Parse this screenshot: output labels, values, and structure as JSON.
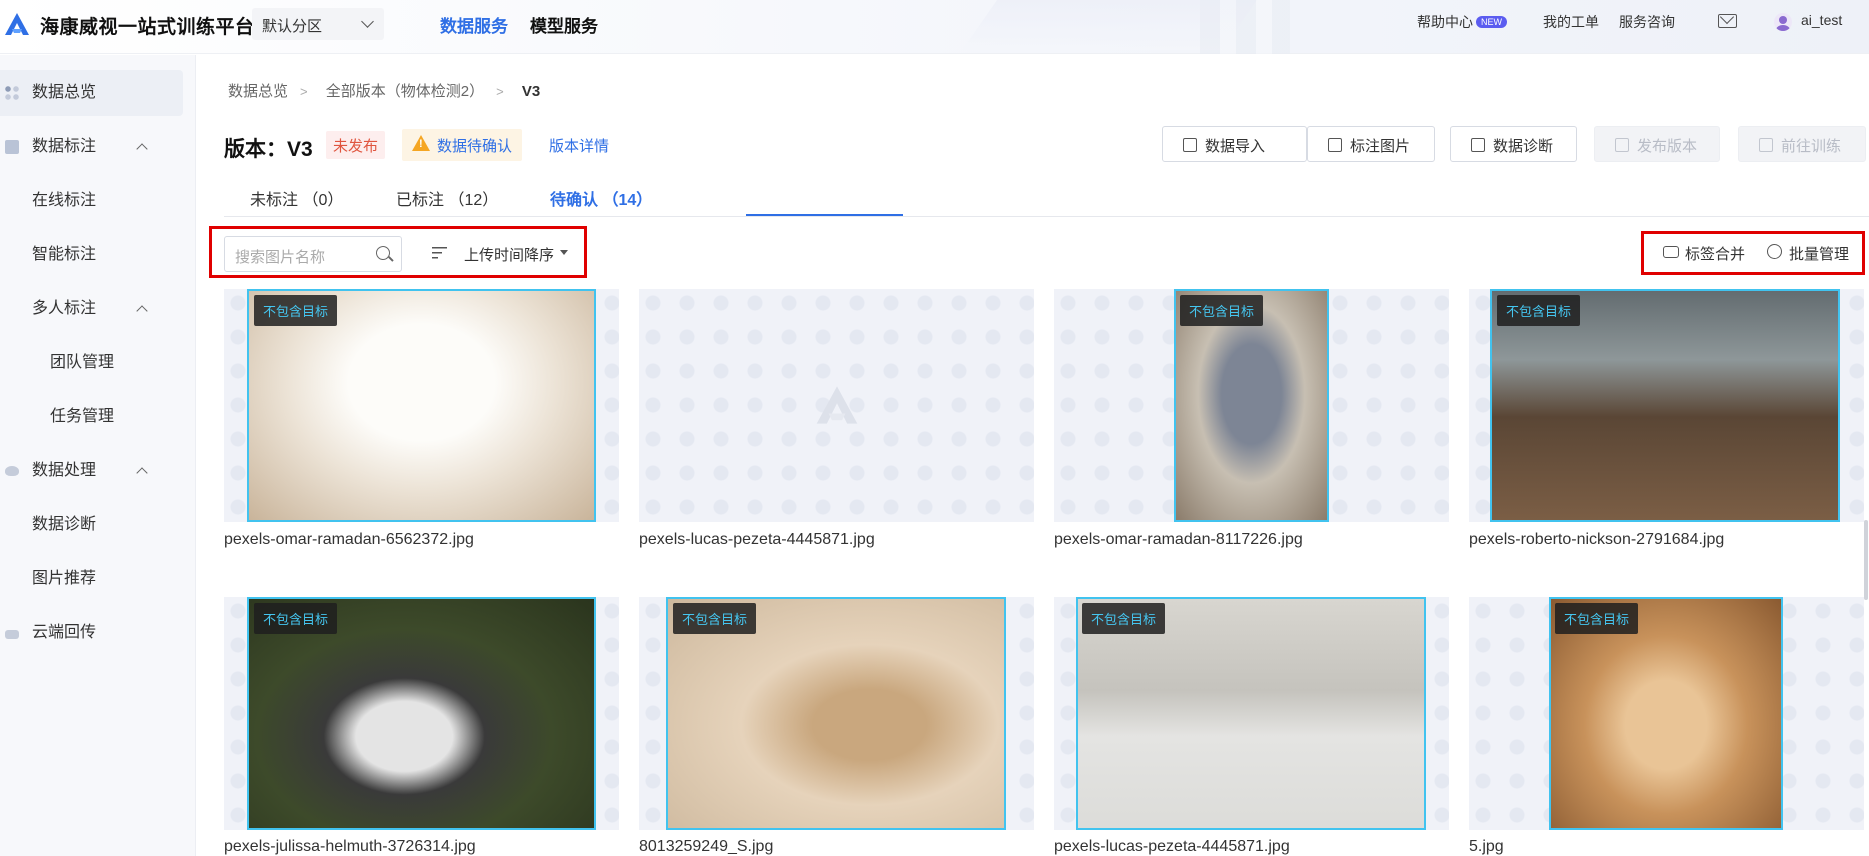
{
  "header": {
    "app_title": "海康威视一站式训练平台",
    "partition": "默认分区",
    "nav": [
      "数据服务",
      "模型服务"
    ],
    "help": "帮助中心",
    "new_badge": "NEW",
    "my_tickets": "我的工单",
    "consult": "服务咨询",
    "user": "ai_test"
  },
  "sidebar": {
    "items": [
      {
        "label": "数据总览",
        "icon": "grid-icon"
      },
      {
        "label": "数据标注",
        "icon": "doc-icon"
      },
      {
        "label": "在线标注"
      },
      {
        "label": "智能标注"
      },
      {
        "label": "多人标注"
      },
      {
        "label": "团队管理"
      },
      {
        "label": "任务管理"
      },
      {
        "label": "数据处理",
        "icon": "leaf-icon"
      },
      {
        "label": "数据诊断"
      },
      {
        "label": "图片推荐"
      },
      {
        "label": "云端回传",
        "icon": "cloud-icon"
      }
    ]
  },
  "breadcrumb": [
    "数据总览",
    "全部版本（物体检测2）",
    "V3"
  ],
  "version": {
    "title": "版本：V3",
    "status_tag": "未发布",
    "pending_tag": "数据待确认",
    "detail_link": "版本详情"
  },
  "toolbar": {
    "import": "数据导入",
    "annotate": "标注图片",
    "diagnose": "数据诊断",
    "publish": "发布版本",
    "train": "前往训练"
  },
  "tabs": [
    "未标注 （0）",
    "已标注 （12）",
    "待确认 （14）"
  ],
  "filters": {
    "search_placeholder": "搜索图片名称",
    "sort": "上传时间降序"
  },
  "actions": {
    "merge": "标签合并",
    "batch": "批量管理"
  },
  "images": [
    {
      "name": "pexels-omar-ramadan-6562372.jpg",
      "badge": "不包含目标"
    },
    {
      "name": "pexels-lucas-pezeta-4445871.jpg",
      "badge": ""
    },
    {
      "name": "pexels-omar-ramadan-8117226.jpg",
      "badge": "不包含目标"
    },
    {
      "name": "pexels-roberto-nickson-2791684.jpg",
      "badge": "不包含目标"
    },
    {
      "name": "pexels-julissa-helmuth-3726314.jpg",
      "badge": "不包含目标"
    },
    {
      "name": "8013259249_S.jpg",
      "badge": "不包含目标"
    },
    {
      "name": "pexels-lucas-pezeta-4445871.jpg",
      "badge": "不包含目标"
    },
    {
      "name": "5.jpg",
      "badge": "不包含目标"
    }
  ],
  "colors": {
    "accent": "#2f6fe5",
    "highlight_box": "#e00000",
    "image_border": "#41c3ef"
  }
}
